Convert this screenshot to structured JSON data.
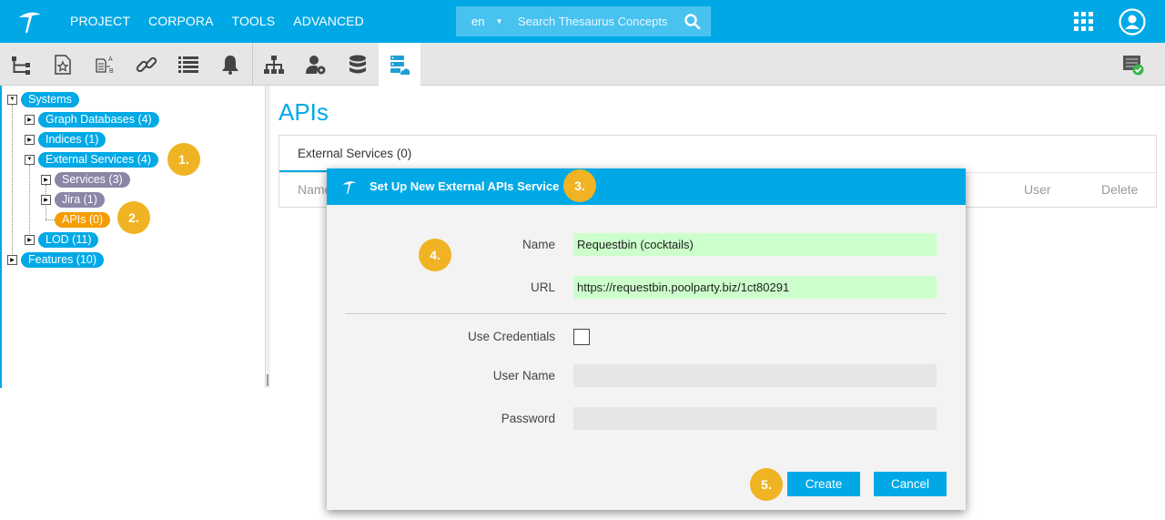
{
  "nav": {
    "items": [
      "PROJECT",
      "CORPORA",
      "TOOLS",
      "ADVANCED"
    ]
  },
  "search": {
    "language": "en",
    "placeholder": "Search Thesaurus Concepts"
  },
  "toolbar": {
    "icons": [
      "hierarchy-icon",
      "starred-document-icon",
      "ab-mapping-icon",
      "link-icon",
      "list-icon",
      "bell-icon",
      "org-chart-icon",
      "user-settings-icon",
      "database-icon",
      "cloud-server-icon",
      "checklist-icon"
    ],
    "active": "cloud-server-icon"
  },
  "tree": {
    "systems": "Systems",
    "graph_databases": "Graph Databases (4)",
    "indices": "Indices (1)",
    "external_services": "External Services (4)",
    "services": "Services (3)",
    "jira": "Jira (1)",
    "apis": "APIs (0)",
    "lod": "LOD (11)",
    "features": "Features (10)"
  },
  "badges": [
    "1.",
    "2.",
    "3.",
    "4.",
    "5."
  ],
  "main": {
    "title": "APIs",
    "tab": "External Services (0)",
    "columns": {
      "name": "Name",
      "user": "User",
      "delete": "Delete"
    }
  },
  "dialog": {
    "title": "Set Up New External APIs Service",
    "name_label": "Name",
    "name_value": "Requestbin (cocktails)",
    "url_label": "URL",
    "url_value": "https://requestbin.poolparty.biz/1ct80291",
    "credentials_label": "Use Credentials",
    "credentials_checked": false,
    "username_label": "User Name",
    "username_value": "",
    "password_label": "Password",
    "password_value": "",
    "create_label": "Create",
    "cancel_label": "Cancel"
  },
  "colors": {
    "brand": "#00a9e6",
    "badge": "#f0b323",
    "selected_node": "#f59d00",
    "filled_field": "#ccffcc"
  }
}
